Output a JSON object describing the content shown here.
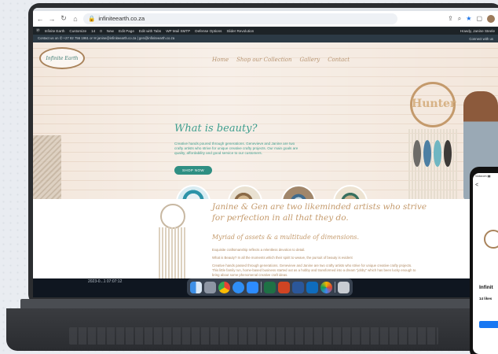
{
  "browser": {
    "url": "infiniteearth.co.za",
    "nav_icons": [
      "back-icon",
      "forward-icon",
      "reload-icon",
      "home-icon"
    ]
  },
  "wp_admin_bar": {
    "items": [
      "Infinite Earth",
      "Customize",
      "14",
      "0",
      "New",
      "Edit Page",
      "Edit with Tabs",
      "WP Mail SMTP",
      "Defense Options",
      "Slider Revolution"
    ],
    "greeting": "Howdy, Janine Steele"
  },
  "info_bar": {
    "contact": "Contact us on ✆ +27 82 756 1961 or ✉ janine@infiniteearth.co.za | gen@infiniteearth.co.za",
    "right": "Connect with us"
  },
  "site": {
    "logo_text": "Infinite Earth",
    "nav": [
      "Home",
      "Shop our Collection",
      "Gallery",
      "Contact"
    ]
  },
  "hero": {
    "title": "What is beauty?",
    "body": "Creative hands poured through generations. Genevieve and Janine are two crafty artists who strive for unique creative crafty projects. Our main goals are quality, affordability and good service to our customers.",
    "button": "SHOP NOW",
    "sign_text": "Hunter"
  },
  "about": {
    "heading": "Janine & Gen are two likeminded artists who strive for perfection in all that they do.",
    "subheading": "Myriad of assets & a multitude of dimensions.",
    "p1": "Exquisite craftsmanship reflects a relentless devotion to detail.",
    "p2": "What is Beauty? In all the moments which their spirit to weave, the pursuit of beauty is evident",
    "p3": "Creative hands passed through generations. Genevieve and Janine are two crafty artists who strive for unique creative crafty projects. This little family run, home-based business started out as a hobby and transformed into a dream \"jobby\" which has been lucky enough to bring about some phenomenal creative craft ideas."
  },
  "desktop": {
    "clock": "2023-0...1 07:07:12"
  },
  "phone": {
    "back": "<",
    "title": "Infinit",
    "likes": "14 likes"
  },
  "colors": {
    "teal": "#2f8f83",
    "gold": "#c49a6c"
  }
}
